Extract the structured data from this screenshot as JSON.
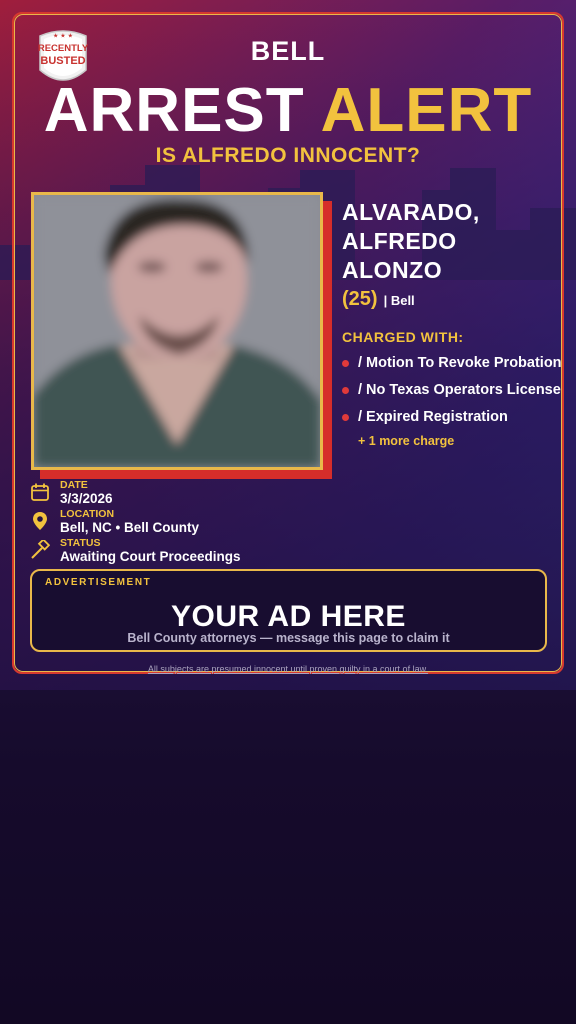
{
  "badge": {
    "line1": "RECENTLY",
    "line2": "BUSTED"
  },
  "header": {
    "city": "BELL",
    "headline_word1": "ARREST",
    "headline_word2": "ALERT",
    "question": "IS ALFREDO INNOCENT?"
  },
  "suspect": {
    "name_line1": "ALVARADO,",
    "name_line2": "ALFREDO",
    "name_line3": "ALONZO",
    "age": "(25)",
    "city": "| Bell"
  },
  "charges": {
    "title": "CHARGED WITH:",
    "items": [
      "/ Motion To Revoke Probation",
      "/ No Texas Operators License",
      "/ Expired Registration"
    ],
    "more": "+ 1 more charge"
  },
  "meta": {
    "date_label": "DATE",
    "date_value": "3/3/2026",
    "location_label": "LOCATION",
    "location_value": "Bell, NC • Bell County",
    "status_label": "STATUS",
    "status_value": "Awaiting Court Proceedings"
  },
  "ad": {
    "label": "ADVERTISEMENT",
    "title": "YOUR AD HERE",
    "subtitle": "Bell County attorneys — message this page to claim it"
  },
  "footer": {
    "disclaimer": "All subjects are presumed innocent until proven guilty in a court of law."
  },
  "colors": {
    "accent_gold": "#f2c23e",
    "accent_red": "#d62d2a",
    "background": "#231342"
  },
  "icons": {
    "badge": "recently-busted-shield-icon",
    "date": "calendar-icon",
    "location": "map-pin-icon",
    "status": "gavel-icon"
  }
}
